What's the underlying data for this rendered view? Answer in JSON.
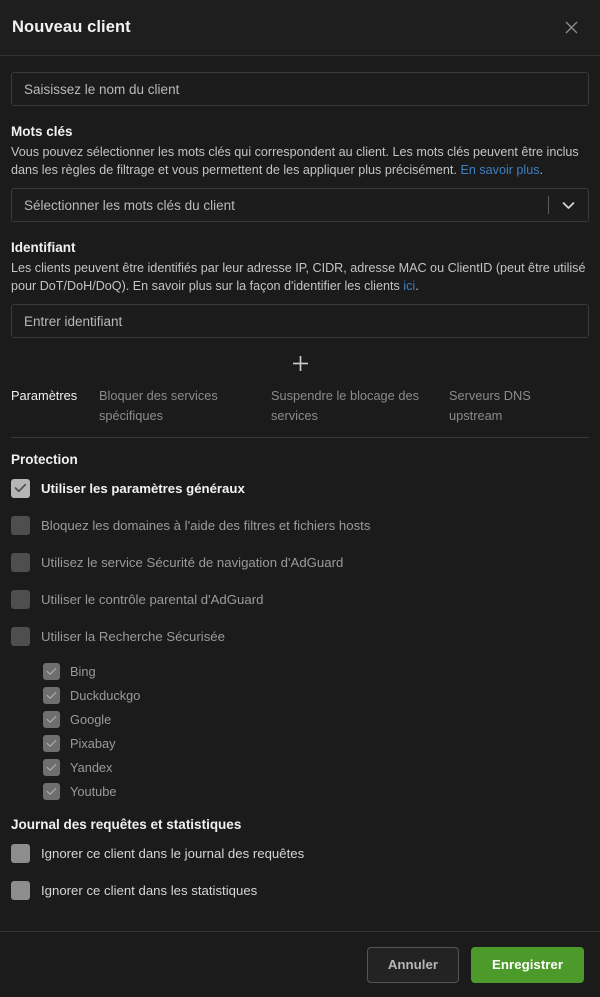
{
  "header": {
    "title": "Nouveau client",
    "close_icon": "close-icon"
  },
  "name_field": {
    "placeholder": "Saisissez le nom du client",
    "value": ""
  },
  "keywords": {
    "label": "Mots clés",
    "description_part1": "Vous pouvez sélectionner les mots clés qui correspondent au client. Les mots clés peuvent être inclus dans les règles de filtrage et vous permettent de les appliquer plus précisément. ",
    "link_text": "En savoir plus",
    "description_part2": ".",
    "select_placeholder": "Sélectionner les mots clés du client",
    "chevron_icon": "chevron-down-icon"
  },
  "identifier": {
    "label": "Identifiant",
    "description_part1": "Les clients peuvent être identifiés par leur adresse IP, CIDR, adresse MAC ou ClientID (peut être utilisé pour DoT/DoH/DoQ). En savoir plus sur la façon d'identifier les clients ",
    "link_text": "ici",
    "description_part2": ".",
    "input_placeholder": "Entrer identifiant",
    "input_value": ""
  },
  "add_button": {
    "icon": "plus-icon",
    "label": "+"
  },
  "tabs": [
    {
      "label": "Paramètres",
      "active": true
    },
    {
      "label": "Bloquer des services spécifiques",
      "active": false
    },
    {
      "label": "Suspendre le blocage des services",
      "active": false
    },
    {
      "label": "Serveurs DNS upstream",
      "active": false
    }
  ],
  "protection": {
    "title": "Protection",
    "items": [
      {
        "label": "Utiliser les paramètres généraux",
        "checked": true,
        "disabled": false,
        "bold": true
      },
      {
        "label": "Bloquez les domaines à l'aide des filtres et fichiers hosts",
        "checked": false,
        "disabled": true,
        "bold": false
      },
      {
        "label": "Utilisez le service Sécurité de navigation d'AdGuard",
        "checked": false,
        "disabled": true,
        "bold": false
      },
      {
        "label": "Utiliser le contrôle parental d'AdGuard",
        "checked": false,
        "disabled": true,
        "bold": false
      },
      {
        "label": "Utiliser la Recherche Sécurisée",
        "checked": false,
        "disabled": true,
        "bold": false
      }
    ],
    "safe_search_engines": [
      {
        "label": "Bing",
        "checked": true,
        "disabled": true
      },
      {
        "label": "Duckduckgo",
        "checked": true,
        "disabled": true
      },
      {
        "label": "Google",
        "checked": true,
        "disabled": true
      },
      {
        "label": "Pixabay",
        "checked": true,
        "disabled": true
      },
      {
        "label": "Yandex",
        "checked": true,
        "disabled": true
      },
      {
        "label": "Youtube",
        "checked": true,
        "disabled": true
      }
    ]
  },
  "logs": {
    "title": "Journal des requêtes et statistiques",
    "items": [
      {
        "label": "Ignorer ce client dans le journal des requêtes",
        "checked": false,
        "disabled": false
      },
      {
        "label": "Ignorer ce client dans les statistiques",
        "checked": false,
        "disabled": false
      }
    ]
  },
  "footer": {
    "cancel_label": "Annuler",
    "save_label": "Enregistrer"
  },
  "colors": {
    "accent_green": "#4c9a2a",
    "link_blue": "#3d7fc1",
    "background": "#1b1b1b",
    "header_background": "#1e1e1e",
    "border": "#3a3a3a"
  }
}
